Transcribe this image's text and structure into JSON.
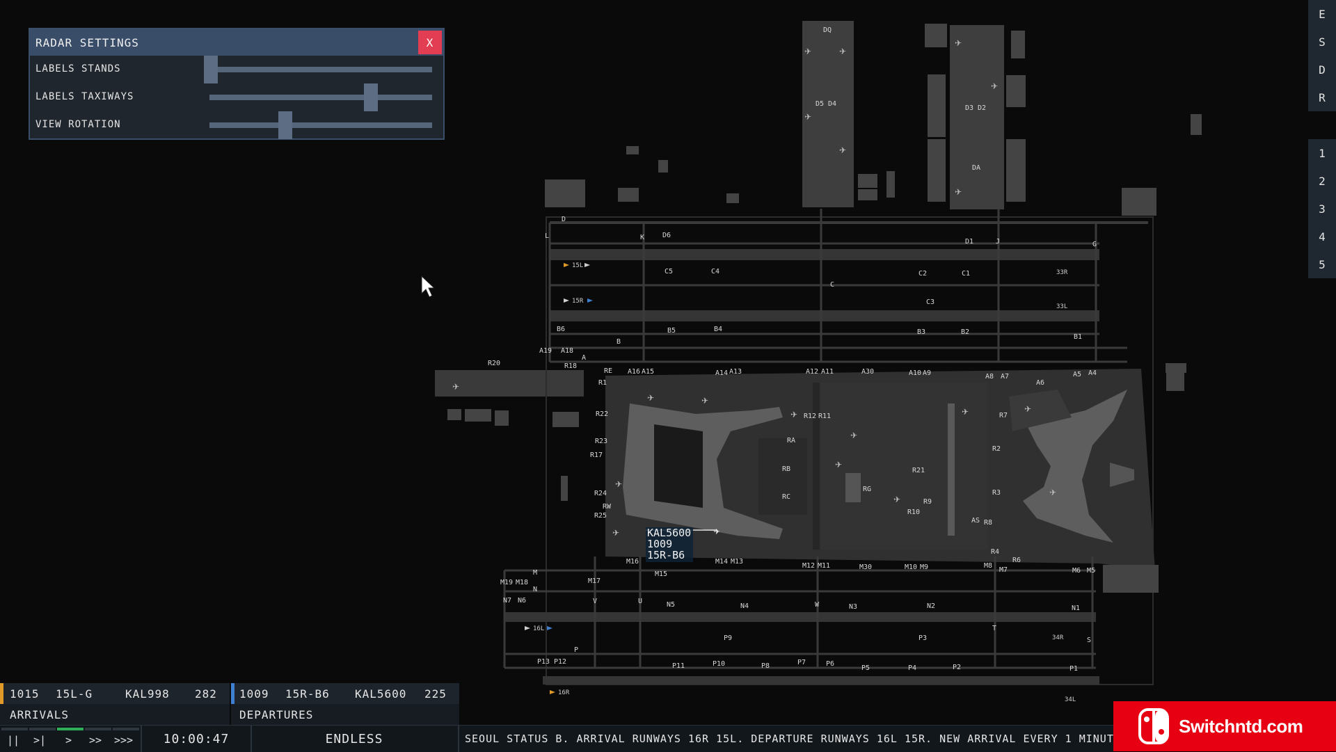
{
  "radar_settings": {
    "title": "RADAR SETTINGS",
    "close_label": "X",
    "rows": [
      {
        "label": "LABELS STANDS",
        "value": 0.0
      },
      {
        "label": "LABELS TAXIWAYS",
        "value": 0.74
      },
      {
        "label": "VIEW ROTATION",
        "value": 0.33
      }
    ]
  },
  "side_menu": {
    "top": [
      "E",
      "S",
      "D",
      "R"
    ],
    "numbers": [
      "1",
      "2",
      "3",
      "4",
      "5"
    ]
  },
  "aircraft_tag": {
    "callsign": "KAL5600",
    "id": "1009",
    "route": "15R-B6"
  },
  "runways": [
    "15L",
    "15R",
    "33R",
    "33L",
    "16L",
    "16R",
    "34R",
    "34L"
  ],
  "taxiway_labels": [
    "DQ",
    "D5",
    "D4",
    "D3",
    "D2",
    "DA",
    "D",
    "D6",
    "D1",
    "K",
    "L",
    "J",
    "G",
    "C5",
    "C4",
    "C2",
    "C1",
    "C",
    "C3",
    "B6",
    "B5",
    "B4",
    "B3",
    "B2",
    "B1",
    "B",
    "A19",
    "A18",
    "A",
    "R20",
    "R18",
    "RE",
    "A16",
    "A15",
    "A14",
    "A13",
    "A12",
    "A11",
    "A30",
    "A10",
    "A9",
    "A8",
    "A7",
    "A6",
    "A5",
    "A4",
    "R1",
    "R22",
    "R23",
    "R17",
    "R24",
    "RW",
    "R25",
    "R12",
    "R11",
    "RA",
    "RB",
    "RC",
    "RG",
    "R21",
    "R10",
    "R9",
    "R2",
    "R3",
    "R7",
    "R8",
    "R4",
    "R6",
    "M19",
    "M18",
    "M17",
    "M16",
    "M15",
    "M14",
    "M13",
    "M12",
    "M11",
    "M30",
    "M10",
    "M9",
    "M8",
    "M7",
    "M6",
    "M5",
    "M",
    "N",
    "N7",
    "N6",
    "N5",
    "N4",
    "N3",
    "N2",
    "N1",
    "V",
    "U",
    "W",
    "P",
    "P9",
    "P10",
    "P11",
    "P13",
    "P12",
    "P8",
    "P7",
    "P6",
    "P5",
    "P4",
    "P3",
    "P2",
    "P1",
    "T",
    "S",
    "AS"
  ],
  "arrival_strip": {
    "id": "1015",
    "runway": "15L-G",
    "callsign": "KAL998",
    "value": "282",
    "label": "ARRIVALS"
  },
  "departure_strip": {
    "id": "1009",
    "runway": "15R-B6",
    "callsign": "KAL5600",
    "value": "225",
    "label": "DEPARTURES"
  },
  "bottom_bar": {
    "speed_controls": [
      "||",
      ">|",
      ">",
      ">>",
      ">>>"
    ],
    "active_speed": 2,
    "clock": "10:00:47",
    "mode": "ENDLESS",
    "status": "SEOUL STATUS B. ARRIVAL RUNWAYS 16R 15L. DEPARTURE RUNWAYS 16L 15R. NEW ARRIVAL EVERY 1 MINUTE"
  },
  "watermark": {
    "text": "Switchntd.com"
  },
  "colors": {
    "panel_header": "#3a4d68",
    "close_button": "#e23d52",
    "arrival_accent": "#e09a2a",
    "departure_accent": "#3f7fd0",
    "active_speed": "#2fae5a",
    "watermark_bg": "#e60012"
  }
}
